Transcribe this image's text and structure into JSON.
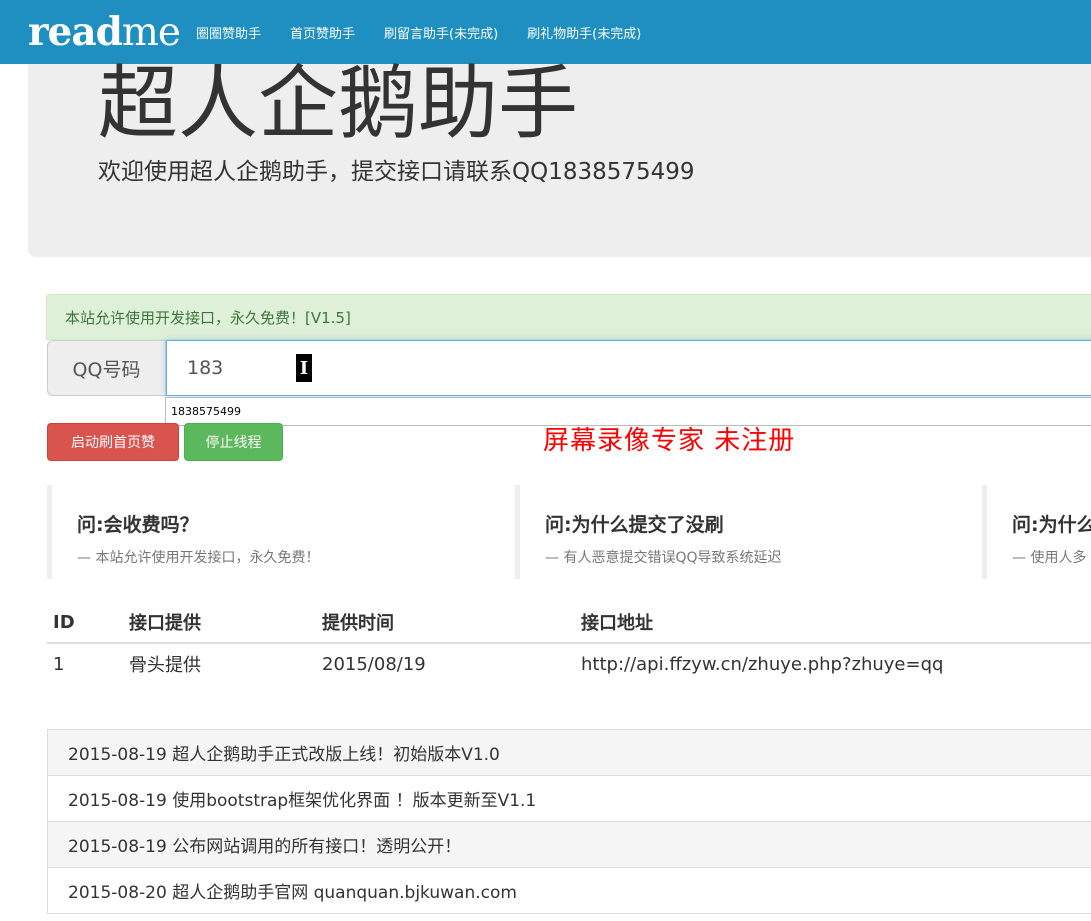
{
  "navbar": {
    "brand_bold": "read",
    "brand_light": "me",
    "links": [
      "圈圈赞助手",
      "首页赞助手",
      "刷留言助手(未完成)",
      "刷礼物助手(未完成)"
    ]
  },
  "jumbotron": {
    "title": "超人企鹅助手",
    "subtitle": "欢迎使用超人企鹅助手，提交接口请联系QQ1838575499"
  },
  "alert": {
    "text": "本站允许使用开发接口，永久免费！[V1.5]"
  },
  "form": {
    "addon_label": "QQ号码",
    "input_value": "183",
    "cursor_glyph": "I",
    "autocomplete_option": "1838575499",
    "start_button": "启动刷首页赞",
    "stop_button": "停止线程"
  },
  "watermark": "屏幕录像专家  未注册",
  "faqs": [
    {
      "q": "问:会收费吗？",
      "a": "— 本站允许使用开发接口，永久免费！"
    },
    {
      "q": "问:为什么提交了没刷",
      "a": "— 有人恶意提交错误QQ导致系统延迟"
    },
    {
      "q": "问:为什么",
      "a": "— 使用人多"
    }
  ],
  "table": {
    "headers": [
      "ID",
      "接口提供",
      "提供时间",
      "接口地址"
    ],
    "rows": [
      [
        "1",
        "骨头提供",
        "2015/08/19",
        "http://api.ffzyw.cn/zhuye.php?zhuye=qq"
      ]
    ]
  },
  "changelog": [
    "2015-08-19 超人企鹅助手正式改版上线！初始版本V1.0",
    "2015-08-19 使用bootstrap框架优化界面 ！版本更新至V1.1",
    "2015-08-19 公布网站调用的所有接口！透明公开！",
    "2015-08-20 超人企鹅助手官网 quanquan.bjkuwan.com"
  ],
  "colors": {
    "navbar": "#1f8fc2",
    "danger": "#d9534f",
    "success": "#5cb85c",
    "alert_bg": "#dff0d8",
    "watermark": "#ff0000"
  }
}
